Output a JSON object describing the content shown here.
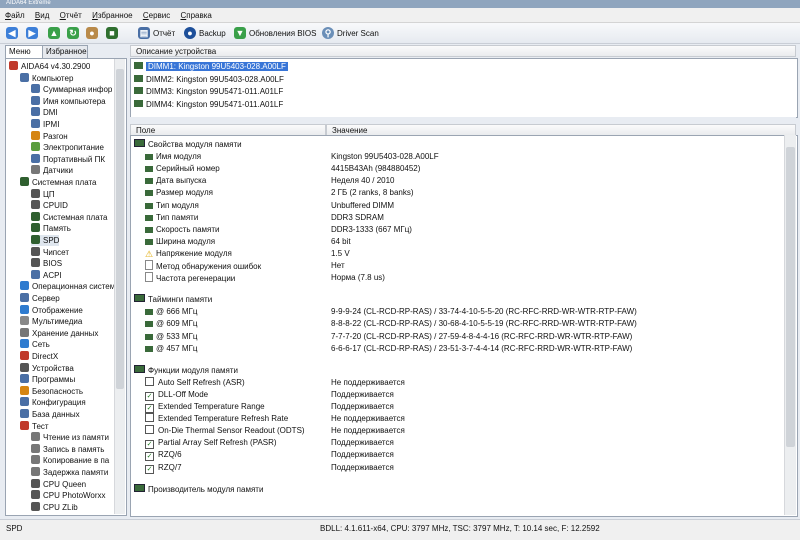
{
  "window": {
    "title": "AIDA64 Extreme"
  },
  "menu": [
    "Файл",
    "Вид",
    "Отчёт",
    "Избранное",
    "Сервис",
    "Справка"
  ],
  "toolbar": {
    "report": "Отчёт",
    "backup": "Backup",
    "bios": "Обновления BIOS",
    "driver": "Driver Scan"
  },
  "tabs": {
    "menu": "Меню",
    "fav": "Избранное"
  },
  "tree": [
    {
      "label": "AIDA64 v4.30.2900",
      "indent": 0,
      "color": "#c0392b"
    },
    {
      "label": "Компьютер",
      "indent": 1,
      "color": "#4a6fa5"
    },
    {
      "label": "Суммарная инфор",
      "indent": 2,
      "color": "#4a6fa5"
    },
    {
      "label": "Имя компьютера",
      "indent": 2,
      "color": "#4a6fa5"
    },
    {
      "label": "DMI",
      "indent": 2,
      "color": "#4a6fa5"
    },
    {
      "label": "IPMI",
      "indent": 2,
      "color": "#4a6fa5"
    },
    {
      "label": "Разгон",
      "indent": 2,
      "color": "#d58512"
    },
    {
      "label": "Электропитание",
      "indent": 2,
      "color": "#5a9d3e"
    },
    {
      "label": "Портативный ПК",
      "indent": 2,
      "color": "#4a6fa5"
    },
    {
      "label": "Датчики",
      "indent": 2,
      "color": "#777"
    },
    {
      "label": "Системная плата",
      "indent": 1,
      "color": "#2f5f2f"
    },
    {
      "label": "ЦП",
      "indent": 2,
      "color": "#555"
    },
    {
      "label": "CPUID",
      "indent": 2,
      "color": "#555"
    },
    {
      "label": "Системная плата",
      "indent": 2,
      "color": "#2f5f2f"
    },
    {
      "label": "Память",
      "indent": 2,
      "color": "#2f5f2f"
    },
    {
      "label": "SPD",
      "indent": 2,
      "color": "#2f5f2f",
      "selected": true
    },
    {
      "label": "Чипсет",
      "indent": 2,
      "color": "#555"
    },
    {
      "label": "BIOS",
      "indent": 2,
      "color": "#555"
    },
    {
      "label": "ACPI",
      "indent": 2,
      "color": "#4a6fa5"
    },
    {
      "label": "Операционная систем",
      "indent": 1,
      "color": "#2e7bcf"
    },
    {
      "label": "Сервер",
      "indent": 1,
      "color": "#4a6fa5"
    },
    {
      "label": "Отображение",
      "indent": 1,
      "color": "#2e7bcf"
    },
    {
      "label": "Мультимедиа",
      "indent": 1,
      "color": "#888"
    },
    {
      "label": "Хранение данных",
      "indent": 1,
      "color": "#777"
    },
    {
      "label": "Сеть",
      "indent": 1,
      "color": "#2e7bcf"
    },
    {
      "label": "DirectX",
      "indent": 1,
      "color": "#c0392b"
    },
    {
      "label": "Устройства",
      "indent": 1,
      "color": "#555"
    },
    {
      "label": "Программы",
      "indent": 1,
      "color": "#4a6fa5"
    },
    {
      "label": "Безопасность",
      "indent": 1,
      "color": "#d58512"
    },
    {
      "label": "Конфигурация",
      "indent": 1,
      "color": "#4a6fa5"
    },
    {
      "label": "База данных",
      "indent": 1,
      "color": "#4a6fa5"
    },
    {
      "label": "Тест",
      "indent": 1,
      "color": "#c0392b"
    },
    {
      "label": "Чтение из памяти",
      "indent": 2,
      "color": "#777"
    },
    {
      "label": "Запись в память",
      "indent": 2,
      "color": "#777"
    },
    {
      "label": "Копирование в па",
      "indent": 2,
      "color": "#777"
    },
    {
      "label": "Задержка памяти",
      "indent": 2,
      "color": "#777"
    },
    {
      "label": "CPU Queen",
      "indent": 2,
      "color": "#555"
    },
    {
      "label": "CPU PhotoWorxx",
      "indent": 2,
      "color": "#555"
    },
    {
      "label": "CPU ZLib",
      "indent": 2,
      "color": "#555"
    }
  ],
  "devices": {
    "header": "Описание устройства",
    "items": [
      "DIMM1: Kingston 99U5403-028.A00LF",
      "DIMM2: Kingston 99U5403-028.A00LF",
      "DIMM3: Kingston 99U5471-011.A01LF",
      "DIMM4: Kingston 99U5471-011.A01LF"
    ]
  },
  "columns": {
    "field": "Поле",
    "value": "Значение"
  },
  "rows": [
    {
      "type": "group",
      "field": "Свойства модуля памяти"
    },
    {
      "type": "item",
      "icon": "ram",
      "field": "Имя модуля",
      "value": "Kingston 99U5403-028.A00LF"
    },
    {
      "type": "item",
      "icon": "ram",
      "field": "Серийный номер",
      "value": "4415B43Ah (984880452)"
    },
    {
      "type": "item",
      "icon": "ram",
      "field": "Дата выпуска",
      "value": "Неделя 40 / 2010"
    },
    {
      "type": "item",
      "icon": "ram",
      "field": "Размер модуля",
      "value": "2 ГБ (2 ranks, 8 banks)"
    },
    {
      "type": "item",
      "icon": "ram",
      "field": "Тип модуля",
      "value": "Unbuffered DIMM"
    },
    {
      "type": "item",
      "icon": "ram",
      "field": "Тип памяти",
      "value": "DDR3 SDRAM"
    },
    {
      "type": "item",
      "icon": "ram",
      "field": "Скорость памяти",
      "value": "DDR3-1333 (667 МГц)"
    },
    {
      "type": "item",
      "icon": "ram",
      "field": "Ширина модуля",
      "value": "64 bit"
    },
    {
      "type": "item",
      "icon": "warn",
      "field": "Напряжение модуля",
      "value": "1.5 V"
    },
    {
      "type": "item",
      "icon": "doc",
      "field": "Метод обнаружения ошибок",
      "value": "Нет"
    },
    {
      "type": "item",
      "icon": "doc",
      "field": "Частота регенерации",
      "value": "Норма (7.8 us)"
    },
    {
      "type": "blank"
    },
    {
      "type": "group",
      "field": "Тайминги памяти"
    },
    {
      "type": "item",
      "icon": "ram",
      "field": "@ 666 МГц",
      "value": "9-9-9-24  (CL-RCD-RP-RAS) / 33-74-4-10-5-5-20  (RC-RFC-RRD-WR-WTR-RTP-FAW)"
    },
    {
      "type": "item",
      "icon": "ram",
      "field": "@ 609 МГц",
      "value": "8-8-8-22  (CL-RCD-RP-RAS) / 30-68-4-10-5-5-19  (RC-RFC-RRD-WR-WTR-RTP-FAW)"
    },
    {
      "type": "item",
      "icon": "ram",
      "field": "@ 533 МГц",
      "value": "7-7-7-20  (CL-RCD-RP-RAS) / 27-59-4-8-4-4-16  (RC-RFC-RRD-WR-WTR-RTP-FAW)"
    },
    {
      "type": "item",
      "icon": "ram",
      "field": "@ 457 МГц",
      "value": "6-6-6-17  (CL-RCD-RP-RAS) / 23-51-3-7-4-4-14  (RC-RFC-RRD-WR-WTR-RTP-FAW)"
    },
    {
      "type": "blank"
    },
    {
      "type": "group",
      "field": "Функции модуля памяти"
    },
    {
      "type": "check",
      "checked": false,
      "field": "Auto Self Refresh (ASR)",
      "value": "Не поддерживается"
    },
    {
      "type": "check",
      "checked": true,
      "field": "DLL-Off Mode",
      "value": "Поддерживается"
    },
    {
      "type": "check",
      "checked": true,
      "field": "Extended Temperature Range",
      "value": "Поддерживается"
    },
    {
      "type": "check",
      "checked": false,
      "field": "Extended Temperature Refresh Rate",
      "value": "Не поддерживается"
    },
    {
      "type": "check",
      "checked": false,
      "field": "On-Die Thermal Sensor Readout (ODTS)",
      "value": "Не поддерживается"
    },
    {
      "type": "check",
      "checked": true,
      "field": "Partial Array Self Refresh (PASR)",
      "value": "Поддерживается"
    },
    {
      "type": "check",
      "checked": true,
      "field": "RZQ/6",
      "value": "Поддерживается"
    },
    {
      "type": "check",
      "checked": true,
      "field": "RZQ/7",
      "value": "Поддерживается"
    },
    {
      "type": "blank"
    },
    {
      "type": "group",
      "field": "Производитель модуля памяти"
    }
  ],
  "status": {
    "left": "SPD",
    "middle": "BDLL: 4.1.611-x64, CPU: 3797 MHz, TSC: 3797 MHz, T: 10.14 sec, F: 12.2592"
  },
  "colors": {
    "selection": "#3875d7",
    "chipgreen": "#3a6a3a"
  }
}
